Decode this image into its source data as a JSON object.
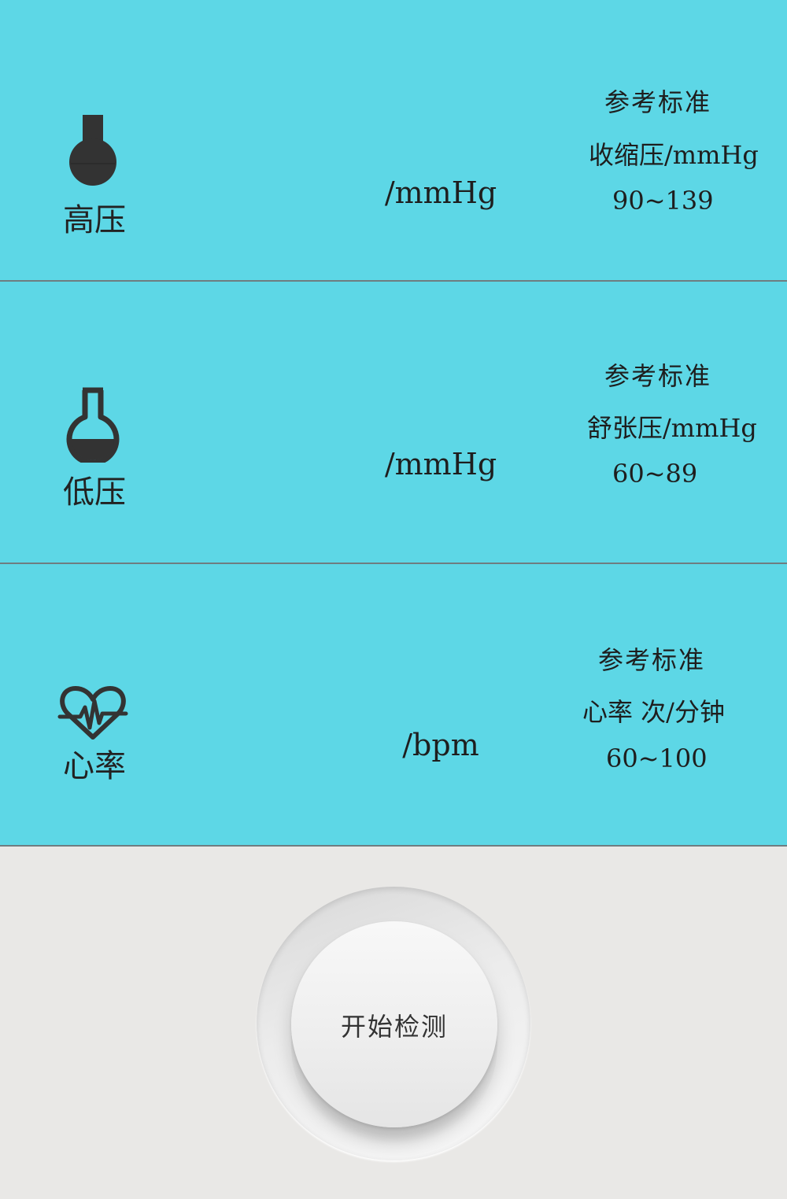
{
  "metrics": [
    {
      "label": "高压",
      "icon": "flask-full-icon",
      "unit": "/mmHg",
      "reference_title": "参考标准",
      "reference_name": "收缩压/mmHg",
      "reference_range": "90~139"
    },
    {
      "label": "低压",
      "icon": "flask-half-icon",
      "unit": "/mmHg",
      "reference_title": "参考标准",
      "reference_name": "舒张压/mmHg",
      "reference_range": "60~89"
    },
    {
      "label": "心率",
      "icon": "heart-pulse-icon",
      "unit": "/bpm",
      "reference_title": "参考标准",
      "reference_name": "心率 次/分钟",
      "reference_range": "60~100"
    }
  ],
  "start_button": {
    "label": "开始检测"
  },
  "colors": {
    "panel_background": "#5dd7e6",
    "lower_background": "#e9e8e6",
    "icon_color": "#333333",
    "divider": "#6f7d80"
  }
}
